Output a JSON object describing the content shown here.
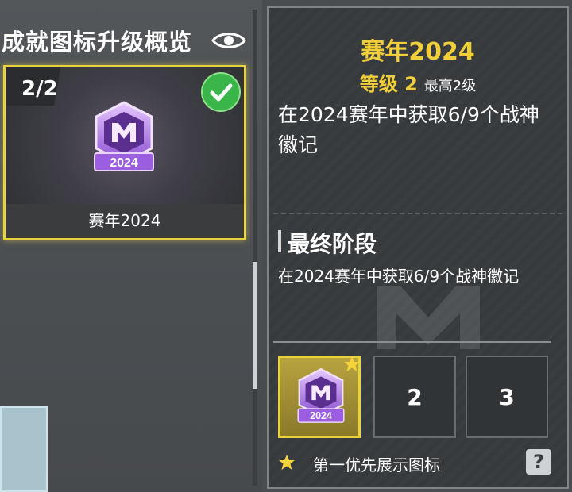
{
  "left_panel": {
    "title": "成就图标升级概览",
    "eye_icon": "eye-icon",
    "card": {
      "count": "2/2",
      "badge_year": "2024",
      "label": "赛年2024",
      "completed_icon": "check-icon"
    }
  },
  "detail_panel": {
    "season_title": "赛年2024",
    "level": "等级 2",
    "max_level": "最高2级",
    "description": "在2024赛年中获取6/9个战神徽记",
    "stage_title": "最终阶段",
    "stage_description": "在2024赛年中获取6/9个战神徽记",
    "slots": [
      {
        "badge_year": "2024",
        "selected": true,
        "priority_icon": "star-icon"
      },
      {
        "label": "2"
      },
      {
        "label": "3"
      }
    ],
    "legend_text": "第一优先展示图标",
    "help_label": "?"
  },
  "colors": {
    "accent_gold": "#f0cf3a",
    "badge_purple": "#b07ae0",
    "check_green": "#39b54a"
  }
}
